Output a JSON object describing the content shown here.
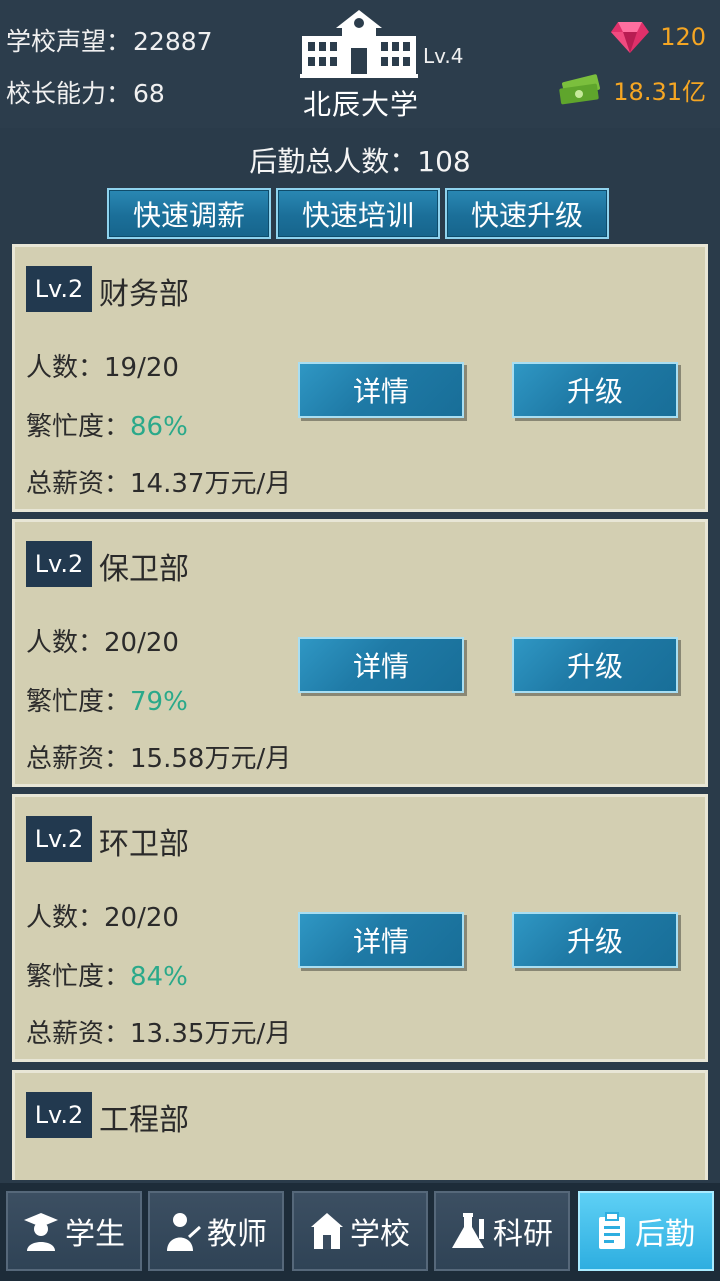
{
  "header": {
    "reputation_label": "学校声望：",
    "reputation_value": "22887",
    "ability_label": "校长能力：",
    "ability_value": "68",
    "school_level": "Lv.4",
    "school_name": "北辰大学",
    "gems": "120",
    "money": "18.31亿",
    "icons": {
      "school": "school-building-icon",
      "gems": "ruby-gem-icon",
      "money": "cash-stack-icon"
    },
    "colors": {
      "resource_text": "#f5a623"
    }
  },
  "logistics": {
    "total_label": "后勤总人数：",
    "total_value": "108",
    "quick_actions": [
      "快速调薪",
      "快速培训",
      "快速升级"
    ]
  },
  "departments": [
    {
      "level": "Lv.2",
      "name": "财务部",
      "staff_label": "人数：",
      "staff": "19/20",
      "busy_label": "繁忙度：",
      "busy": "86%",
      "salary_label": "总薪资：",
      "salary": "14.37万元/月",
      "detail_label": "详情",
      "upgrade_label": "升级"
    },
    {
      "level": "Lv.2",
      "name": "保卫部",
      "staff_label": "人数：",
      "staff": "20/20",
      "busy_label": "繁忙度：",
      "busy": "79%",
      "salary_label": "总薪资：",
      "salary": "15.58万元/月",
      "detail_label": "详情",
      "upgrade_label": "升级"
    },
    {
      "level": "Lv.2",
      "name": "环卫部",
      "staff_label": "人数：",
      "staff": "20/20",
      "busy_label": "繁忙度：",
      "busy": "84%",
      "salary_label": "总薪资：",
      "salary": "13.35万元/月",
      "detail_label": "详情",
      "upgrade_label": "升级"
    },
    {
      "level": "Lv.2",
      "name": "工程部"
    }
  ],
  "tabs": [
    {
      "label": "学生",
      "icon": "student-graduate-icon",
      "active": false
    },
    {
      "label": "教师",
      "icon": "teacher-icon",
      "active": false
    },
    {
      "label": "学校",
      "icon": "school-icon",
      "active": false
    },
    {
      "label": "科研",
      "icon": "flask-icon",
      "active": false
    },
    {
      "label": "后勤",
      "icon": "clipboard-icon",
      "active": true
    }
  ],
  "colors": {
    "busy_value": "#2aa98a",
    "card_bg": "#d3cfb2",
    "active_tab": "#2eaee0"
  }
}
